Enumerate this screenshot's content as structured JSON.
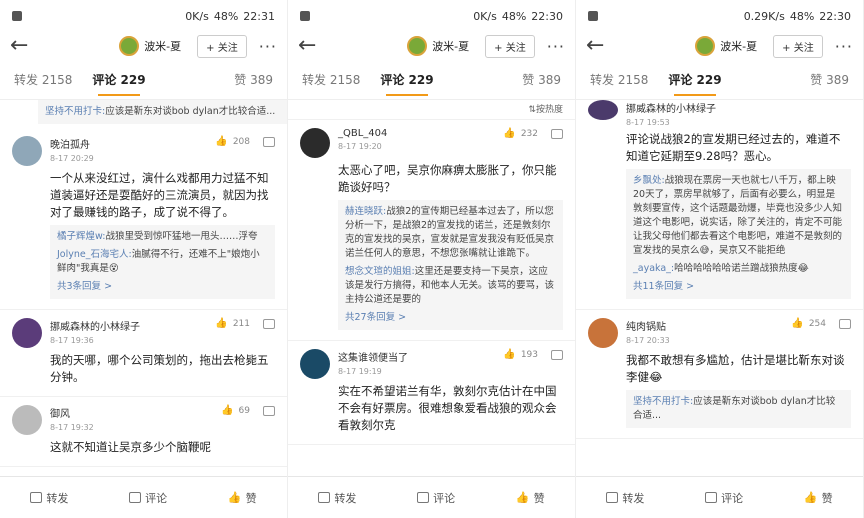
{
  "panels": [
    {
      "status": {
        "speed": "0K/s",
        "battery": "48%",
        "time": "22:30"
      },
      "header": {
        "user": "波米-夏",
        "follow": "+ 关注",
        "more": "···"
      },
      "tabs": {
        "repost": "转发 2158",
        "comment": "评论 229",
        "likes": "赞 389"
      },
      "sort_label": "⇅按热度",
      "comments": [
        {
          "name": "_QBL_404",
          "time": "8-17 19:20",
          "likes": "232",
          "text": "太恶心了吧，吴京你麻痹太膨胀了，你只能跪谈好吗？",
          "replies": [
            {
              "user": "赫连晓跃:",
              "text": "战狼2的宣传期已经基本过去了，所以您分析一下，是战狼2的宣发找的诺兰，还是敦刻尔克的宣发找的吴京，宣发就是宣发我没有贬低吴京诺兰任何人的意思，不想您张嘴就让谁跪下。"
            },
            {
              "user": "想念文瑄的姐姐:",
              "text": "这里还是要支持一下吴京，这应该是发行方搞得，和他本人无关。该骂的要骂，该主持公道还是要的"
            }
          ],
          "more": "共27条回复 >"
        },
        {
          "name": "这集谁领便当了",
          "time": "8-17 19:19",
          "likes": "193",
          "text": "实在不希望诺兰有华，敦刻尔克估计在中国不会有好票房。很难想象爱看战狼的观众会看敦刻尔克",
          "replies": [],
          "more": ""
        }
      ],
      "bottom": {
        "repost": "转发",
        "comment": "评论",
        "like": "赞"
      }
    },
    {
      "status": {
        "speed": "0.29K/s",
        "battery": "48%",
        "time": "22:30"
      },
      "header": {
        "user": "波米-夏",
        "follow": "+ 关注",
        "more": "···"
      },
      "tabs": {
        "repost": "转发 2158",
        "comment": "评论 229",
        "likes": "赞 389"
      },
      "sort_label": "",
      "comments": [
        {
          "name": "挪威森林的小林绿子",
          "time": "8-17 19:53",
          "likes": "",
          "text": "评论说战狼2的宣发期已经过去的，难道不知道它延期至9.28吗？恶心。",
          "replies": [
            {
              "user": "乡飘处:",
              "text": "战狼现在票房一天也就七八千万，都上映20天了，票房早就够了，后面有必要么，明显是敦刻要宣传，这个话题最劲爆，毕竟也没多少人知道这个电影吧，说实话，除了关注的，肯定不可能让我父母他们都去看这个电影吧，难道不是敦刻的宣发找的吴京么😅，吴京又不能拒绝"
            },
            {
              "user": "_ayaka_:",
              "text": "哈哈哈哈哈哈诺兰蹭战狼热度😂"
            }
          ],
          "more": "共11条回复 >"
        },
        {
          "name": "纯肉锅贴",
          "time": "8-17 20:33",
          "likes": "254",
          "text": "我都不敢想有多尴尬，估计是堪比靳东对谈李健😂",
          "replies": [
            {
              "user": "坚持不用打卡:",
              "text": "应该是靳东对谈bob dylan才比较合适..."
            }
          ],
          "more": ""
        }
      ],
      "bottom": {
        "repost": "转发",
        "comment": "评论",
        "like": "赞"
      }
    },
    {
      "status": {
        "speed": "0K/s",
        "battery": "48%",
        "time": "22:31"
      },
      "header": {
        "user": "波米-夏",
        "follow": "+ 关注",
        "more": "···"
      },
      "tabs": {
        "repost": "转发 2158",
        "comment": "评论 229",
        "likes": "赞 389"
      },
      "sort_label": "",
      "top_reply": {
        "user": "坚持不用打卡:",
        "text": "应该是靳东对谈bob dylan才比较合适..."
      },
      "comments": [
        {
          "name": "晚泊孤舟",
          "time": "8-17 20:29",
          "likes": "208",
          "text": "一个从来没红过，演什么戏都用力过猛不知道装逼好还是耍酷好的三流演员，就因为找对了最赚钱的路子，成了说不得了。",
          "replies": [
            {
              "user": "橘子辉煌w:",
              "text": "战狼里受到惊吓猛地一甩头……浮夸"
            },
            {
              "user": "Jolyne_石海宅人:",
              "text": "油腻得不行，还难不上\"娘炮小鲜肉\"我真是😵"
            }
          ],
          "more": "共3条回复 >"
        },
        {
          "name": "挪威森林的小林绿子",
          "time": "8-17 19:36",
          "likes": "211",
          "text": "我的天哪，哪个公司策划的，拖出去枪毙五分钟。",
          "replies": [],
          "more": ""
        },
        {
          "name": "御风",
          "time": "8-17 19:32",
          "likes": "69",
          "text": "这就不知道让吴京多少个脑鞭呢",
          "replies": [],
          "more": ""
        }
      ],
      "bottom": {
        "repost": "转发",
        "comment": "评论",
        "like": "赞"
      }
    }
  ],
  "colors": {
    "accent": "#f29a18",
    "link": "#5a7fb2"
  }
}
